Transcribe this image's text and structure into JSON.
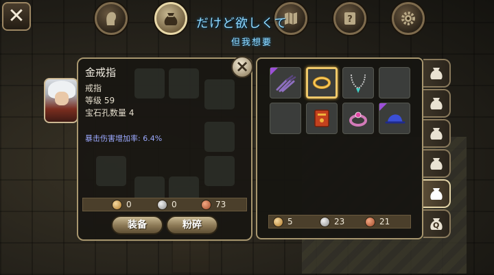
{
  "header": {
    "close_label": "✕",
    "title": "だけど欲しくて",
    "subtitle": "但我想要",
    "nav_buttons": [
      "character",
      "bag",
      "map",
      "quest",
      "settings"
    ]
  },
  "detail": {
    "item_name": "金戒指",
    "item_type": "戒指",
    "level_line": "等级 59",
    "gems_line": "宝石孔数量 4",
    "stat_line": "暴击伤害增加率: 6.4%",
    "close_label": "×",
    "price": {
      "gold": "0",
      "silver": "0",
      "copper": "73"
    },
    "equip_label": "装备",
    "smash_label": "粉碎"
  },
  "inventory": {
    "items": [
      {
        "icon": "claw-weapon-icon",
        "rarity": "rare"
      },
      {
        "icon": "gold-ring-icon",
        "selected": true
      },
      {
        "icon": "necklace-icon"
      },
      {
        "icon": "empty"
      },
      {
        "icon": "empty"
      },
      {
        "icon": "spellbook-icon"
      },
      {
        "icon": "pink-ring-icon"
      },
      {
        "icon": "blue-hat-icon",
        "rarity": "rare"
      }
    ],
    "currency": {
      "gold": "5",
      "silver": "23",
      "copper": "21"
    }
  },
  "tabs": [
    "bag-tab-1",
    "bag-tab-2",
    "bag-tab-3",
    "bag-tab-4",
    "bag-tab-5",
    "quest-bag-tab"
  ],
  "tab_quest_letter": "Q",
  "colors": {
    "accent_title": "#8fd9ff",
    "panel_border": "#a8976f",
    "selected_slot": "#f0c96a",
    "rare": "#9c4fd8",
    "stat_text": "#9ca9ff"
  }
}
